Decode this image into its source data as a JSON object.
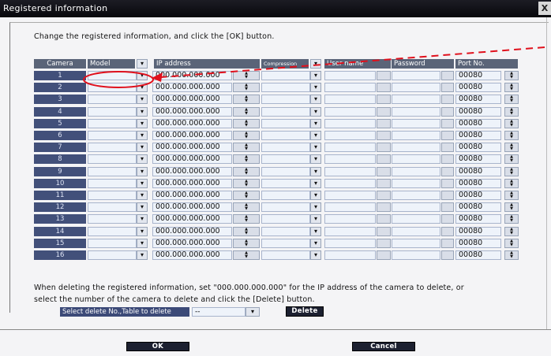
{
  "window": {
    "title": "Registered information",
    "close_glyph": "X"
  },
  "instruction": "Change the registered information, and click the [OK] button.",
  "table": {
    "headers": {
      "camera": "Camera",
      "model": "Model",
      "ip": "IP address",
      "compression": "Compression",
      "username": "User name",
      "password": "Password",
      "port": "Port No."
    },
    "dropdown_glyph": "▾",
    "rows": [
      {
        "camera": "1",
        "ip": "000.000.000.000",
        "port": "00080"
      },
      {
        "camera": "2",
        "ip": "000.000.000.000",
        "port": "00080"
      },
      {
        "camera": "3",
        "ip": "000.000.000.000",
        "port": "00080"
      },
      {
        "camera": "4",
        "ip": "000.000.000.000",
        "port": "00080"
      },
      {
        "camera": "5",
        "ip": "000.000.000.000",
        "port": "00080"
      },
      {
        "camera": "6",
        "ip": "000.000.000.000",
        "port": "00080"
      },
      {
        "camera": "7",
        "ip": "000.000.000.000",
        "port": "00080"
      },
      {
        "camera": "8",
        "ip": "000.000.000.000",
        "port": "00080"
      },
      {
        "camera": "9",
        "ip": "000.000.000.000",
        "port": "00080"
      },
      {
        "camera": "10",
        "ip": "000.000.000.000",
        "port": "00080"
      },
      {
        "camera": "11",
        "ip": "000.000.000.000",
        "port": "00080"
      },
      {
        "camera": "12",
        "ip": "000.000.000.000",
        "port": "00080"
      },
      {
        "camera": "13",
        "ip": "000.000.000.000",
        "port": "00080"
      },
      {
        "camera": "14",
        "ip": "000.000.000.000",
        "port": "00080"
      },
      {
        "camera": "15",
        "ip": "000.000.000.000",
        "port": "00080"
      },
      {
        "camera": "16",
        "ip": "000.000.000.000",
        "port": "00080"
      }
    ]
  },
  "delete_note": {
    "line1": "When deleting the registered information, set \"000.000.000.000\" for the IP address of the camera to delete, or",
    "line2": "select the number of the camera to delete and click the [Delete] button."
  },
  "delete_row": {
    "label": "Select delete No.,Table to delete",
    "value": "--",
    "delete_label": "Delete"
  },
  "buttons": {
    "ok": "OK",
    "cancel": "Cancel"
  },
  "colors": {
    "annotation_red": "#e0101c",
    "header_bg": "#5a6478",
    "camera_cell_bg": "#42507a"
  }
}
